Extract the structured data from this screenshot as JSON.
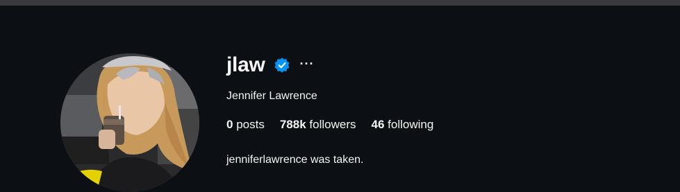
{
  "profile": {
    "username": "jlaw",
    "verified": true,
    "more_label": "···",
    "full_name": "Jennifer Lawrence",
    "stats": [
      {
        "count": "0",
        "label": "posts"
      },
      {
        "count": "788k",
        "label": "followers"
      },
      {
        "count": "46",
        "label": "following"
      }
    ],
    "bio": "jenniferlawrence was taken."
  },
  "icons": {
    "verified": "verified-badge-icon",
    "more": "more-options-icon"
  },
  "colors": {
    "background": "#0c1014",
    "text": "#f5f5f5",
    "verified_blue": "#0095f6"
  }
}
